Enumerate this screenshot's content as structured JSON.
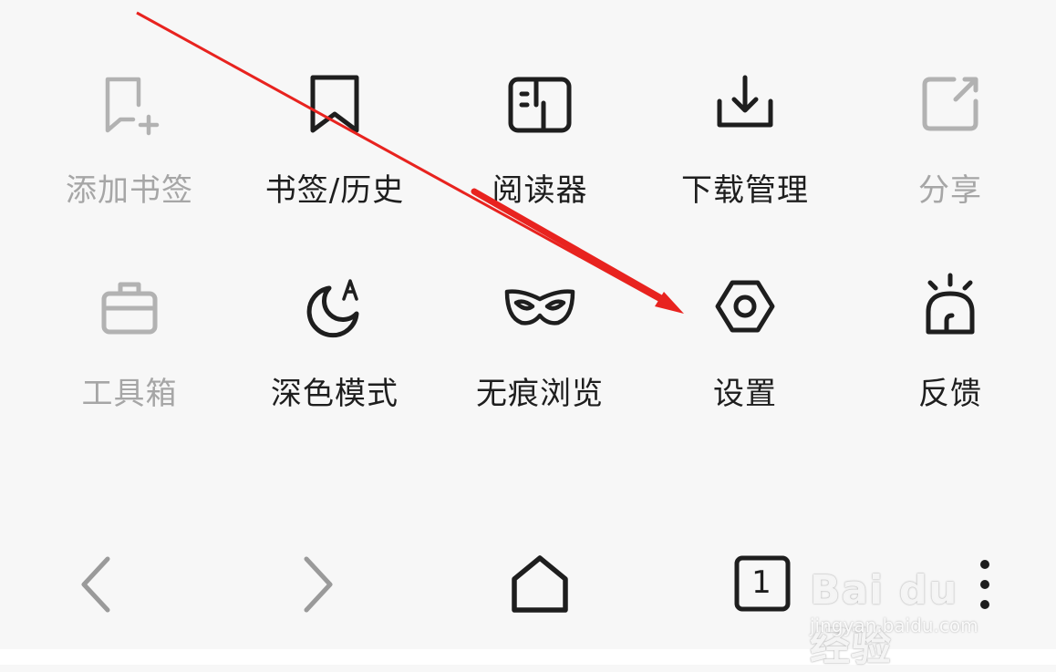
{
  "menu": {
    "items": [
      {
        "label": "添加书签",
        "icon": "bookmark-add-icon",
        "enabled": false
      },
      {
        "label": "书签/历史",
        "icon": "bookmark-icon",
        "enabled": true
      },
      {
        "label": "阅读器",
        "icon": "reader-icon",
        "enabled": true
      },
      {
        "label": "下载管理",
        "icon": "download-icon",
        "enabled": true
      },
      {
        "label": "分享",
        "icon": "share-icon",
        "enabled": false
      },
      {
        "label": "工具箱",
        "icon": "toolbox-icon",
        "enabled": false
      },
      {
        "label": "深色模式",
        "icon": "dark-mode-icon",
        "enabled": true
      },
      {
        "label": "无痕浏览",
        "icon": "incognito-mask-icon",
        "enabled": true
      },
      {
        "label": "设置",
        "icon": "settings-icon",
        "enabled": true
      },
      {
        "label": "反馈",
        "icon": "feedback-siren-icon",
        "enabled": true
      }
    ]
  },
  "bottom_nav": {
    "back_icon": "chevron-left-icon",
    "forward_icon": "chevron-right-icon",
    "home_icon": "home-icon",
    "tab_count": "1",
    "more_icon": "more-vertical-icon"
  },
  "watermark": {
    "logo": "Bai du 经验",
    "url": "jingyan.baidu.com"
  },
  "colors": {
    "background": "#f7f7f7",
    "icon_enabled": "#1e1e1e",
    "icon_disabled": "#b2b2b2",
    "annotation_arrow": "#e8231f"
  }
}
